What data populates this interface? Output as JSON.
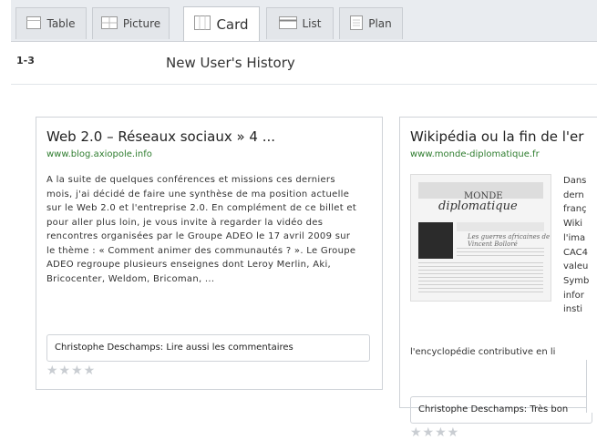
{
  "toolbar": {
    "tabs": [
      {
        "label": "Table",
        "icon": "table-icon",
        "active": false
      },
      {
        "label": "Picture",
        "icon": "picture-icon",
        "active": false
      },
      {
        "label": "Card",
        "icon": "card-icon",
        "active": true
      },
      {
        "label": "List",
        "icon": "list-icon",
        "active": false
      },
      {
        "label": "Plan",
        "icon": "plan-icon",
        "active": false
      }
    ]
  },
  "header": {
    "range": "1-3",
    "title": "New User's History"
  },
  "cards": [
    {
      "title": "Web 2.0 – Réseaux sociaux » 4 ...",
      "url": "www.blog.axiopole.info",
      "text": "A la suite de quelques conférences et missions ces derniers mois, j'ai décidé de faire une synthèse de ma position actuelle sur le Web 2.0 et l'entreprise 2.0. En complément de ce billet et pour aller plus loin, je vous invite à regarder la vidéo des rencontres organisées par le Groupe ADEO le 17 avril 2009 sur le thème : « Comment animer des communautés ? ». Le Groupe ADEO regroupe plusieurs enseignes dont Leroy Merlin, Aki, Bricocenter, Weldom, Bricoman, ...",
      "comment": "Christophe Deschamps: Lire aussi les commentaires",
      "stars": "★★★★"
    },
    {
      "title": "Wikipédia ou la fin de l'er",
      "url": "www.monde-diplomatique.fr",
      "thumb_masthead": "MONDE",
      "thumb_logo": "diplomatique",
      "thumb_headline": "Les guerres africaines de Vincent Bolloré",
      "side_text": "Dans\ndern\nfranç\nWiki\nl'ima\nCAC4\nvaleu\nSymb\ninfor\ninsti",
      "tail_text": "l'encyclopédie contributive en li",
      "comment": "Christophe Deschamps: Très bon",
      "stars": "★★★★"
    }
  ]
}
